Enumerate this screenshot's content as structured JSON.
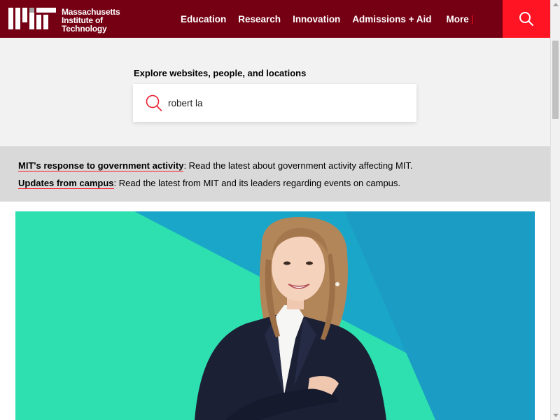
{
  "header": {
    "logo_lines": [
      "Massachusetts",
      "Institute of",
      "Technology"
    ],
    "nav": [
      "Education",
      "Research",
      "Innovation",
      "Admissions + Aid",
      "More"
    ],
    "search_button_icon": "search-icon"
  },
  "search": {
    "label": "Explore websites, people, and locations",
    "value": "robert la",
    "icon": "search-icon"
  },
  "alerts": [
    {
      "link": "MIT's response to government activity",
      "text": ": Read the latest about government activity affecting MIT."
    },
    {
      "link": "Updates from campus",
      "text": ": Read the latest from MIT and its leaders regarding events on campus."
    }
  ],
  "colors": {
    "header_bg": "#750014",
    "accent_red": "#ff1423",
    "teal": "#2ee0b0",
    "blue": "#1aa6c8"
  }
}
